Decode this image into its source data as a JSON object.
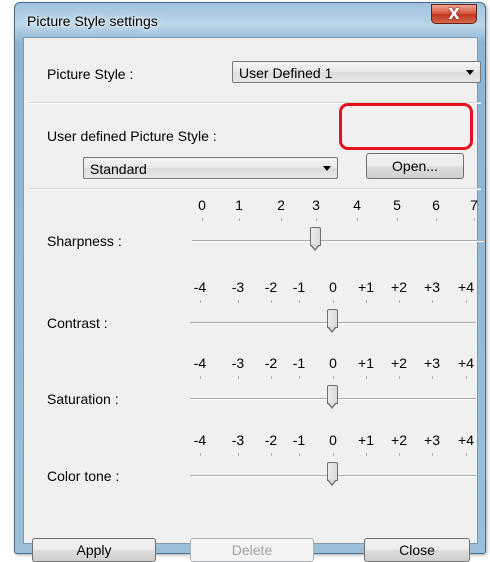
{
  "window": {
    "title": "Picture Style settings",
    "close_glyph": "X"
  },
  "picture_style": {
    "label": "Picture Style :",
    "selected": "User Defined 1"
  },
  "user_defined": {
    "label": "User defined Picture Style :",
    "selected": "Standard",
    "open_label": "Open..."
  },
  "sliders": [
    {
      "name": "sharpness",
      "label": "Sharpness :",
      "ticks": [
        "0",
        "1",
        "2",
        "3",
        "4",
        "5",
        "6",
        "7"
      ],
      "value": "3"
    },
    {
      "name": "contrast",
      "label": "Contrast :",
      "ticks": [
        "-4",
        "-3",
        "-2",
        "-1",
        "0",
        "+1",
        "+2",
        "+3",
        "+4"
      ],
      "value": "0"
    },
    {
      "name": "saturation",
      "label": "Saturation :",
      "ticks": [
        "-4",
        "-3",
        "-2",
        "-1",
        "0",
        "+1",
        "+2",
        "+3",
        "+4"
      ],
      "value": "0"
    },
    {
      "name": "color-tone",
      "label": "Color tone :",
      "ticks": [
        "-4",
        "-3",
        "-2",
        "-1",
        "0",
        "+1",
        "+2",
        "+3",
        "+4"
      ],
      "value": "0"
    }
  ],
  "buttons": {
    "apply": "Apply",
    "delete": "Delete",
    "close": "Close"
  },
  "colors": {
    "highlight": "#e8101c",
    "titlebar": "#9fc3dd",
    "close_button": "#c2331c"
  }
}
